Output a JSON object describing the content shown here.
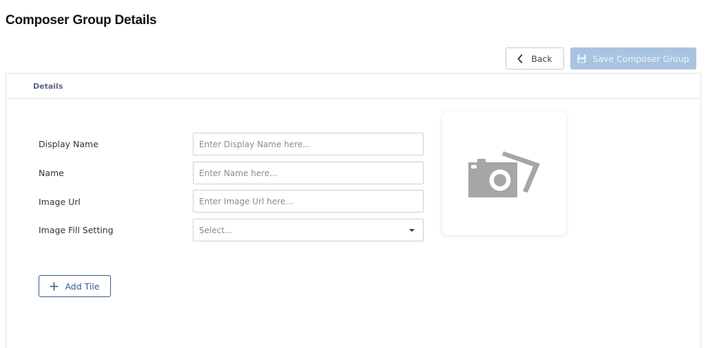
{
  "page": {
    "title": "Composer Group Details"
  },
  "toolbar": {
    "back_label": "Back",
    "save_label": "Save Composer Group",
    "save_disabled": true
  },
  "tabs": [
    {
      "label": "Details",
      "active": true
    }
  ],
  "form": {
    "fields": [
      {
        "label": "Display Name",
        "placeholder": "Enter Display Name here...",
        "value": ""
      },
      {
        "label": "Name",
        "placeholder": "Enter Name here...",
        "value": ""
      },
      {
        "label": "Image Url",
        "placeholder": "Enter Image Url here...",
        "value": ""
      },
      {
        "label": "Image Fill Setting",
        "placeholder": "Select...",
        "value": ""
      }
    ]
  },
  "image_preview": {
    "icon": "camera-placeholder-icon"
  },
  "actions": {
    "add_tile_label": "Add Tile"
  },
  "colors": {
    "primary": "#2f5d8e",
    "save_disabled_bg": "#a9c4e0",
    "tab_text": "#5a6585",
    "placeholder_icon": "#a6a6a6"
  }
}
